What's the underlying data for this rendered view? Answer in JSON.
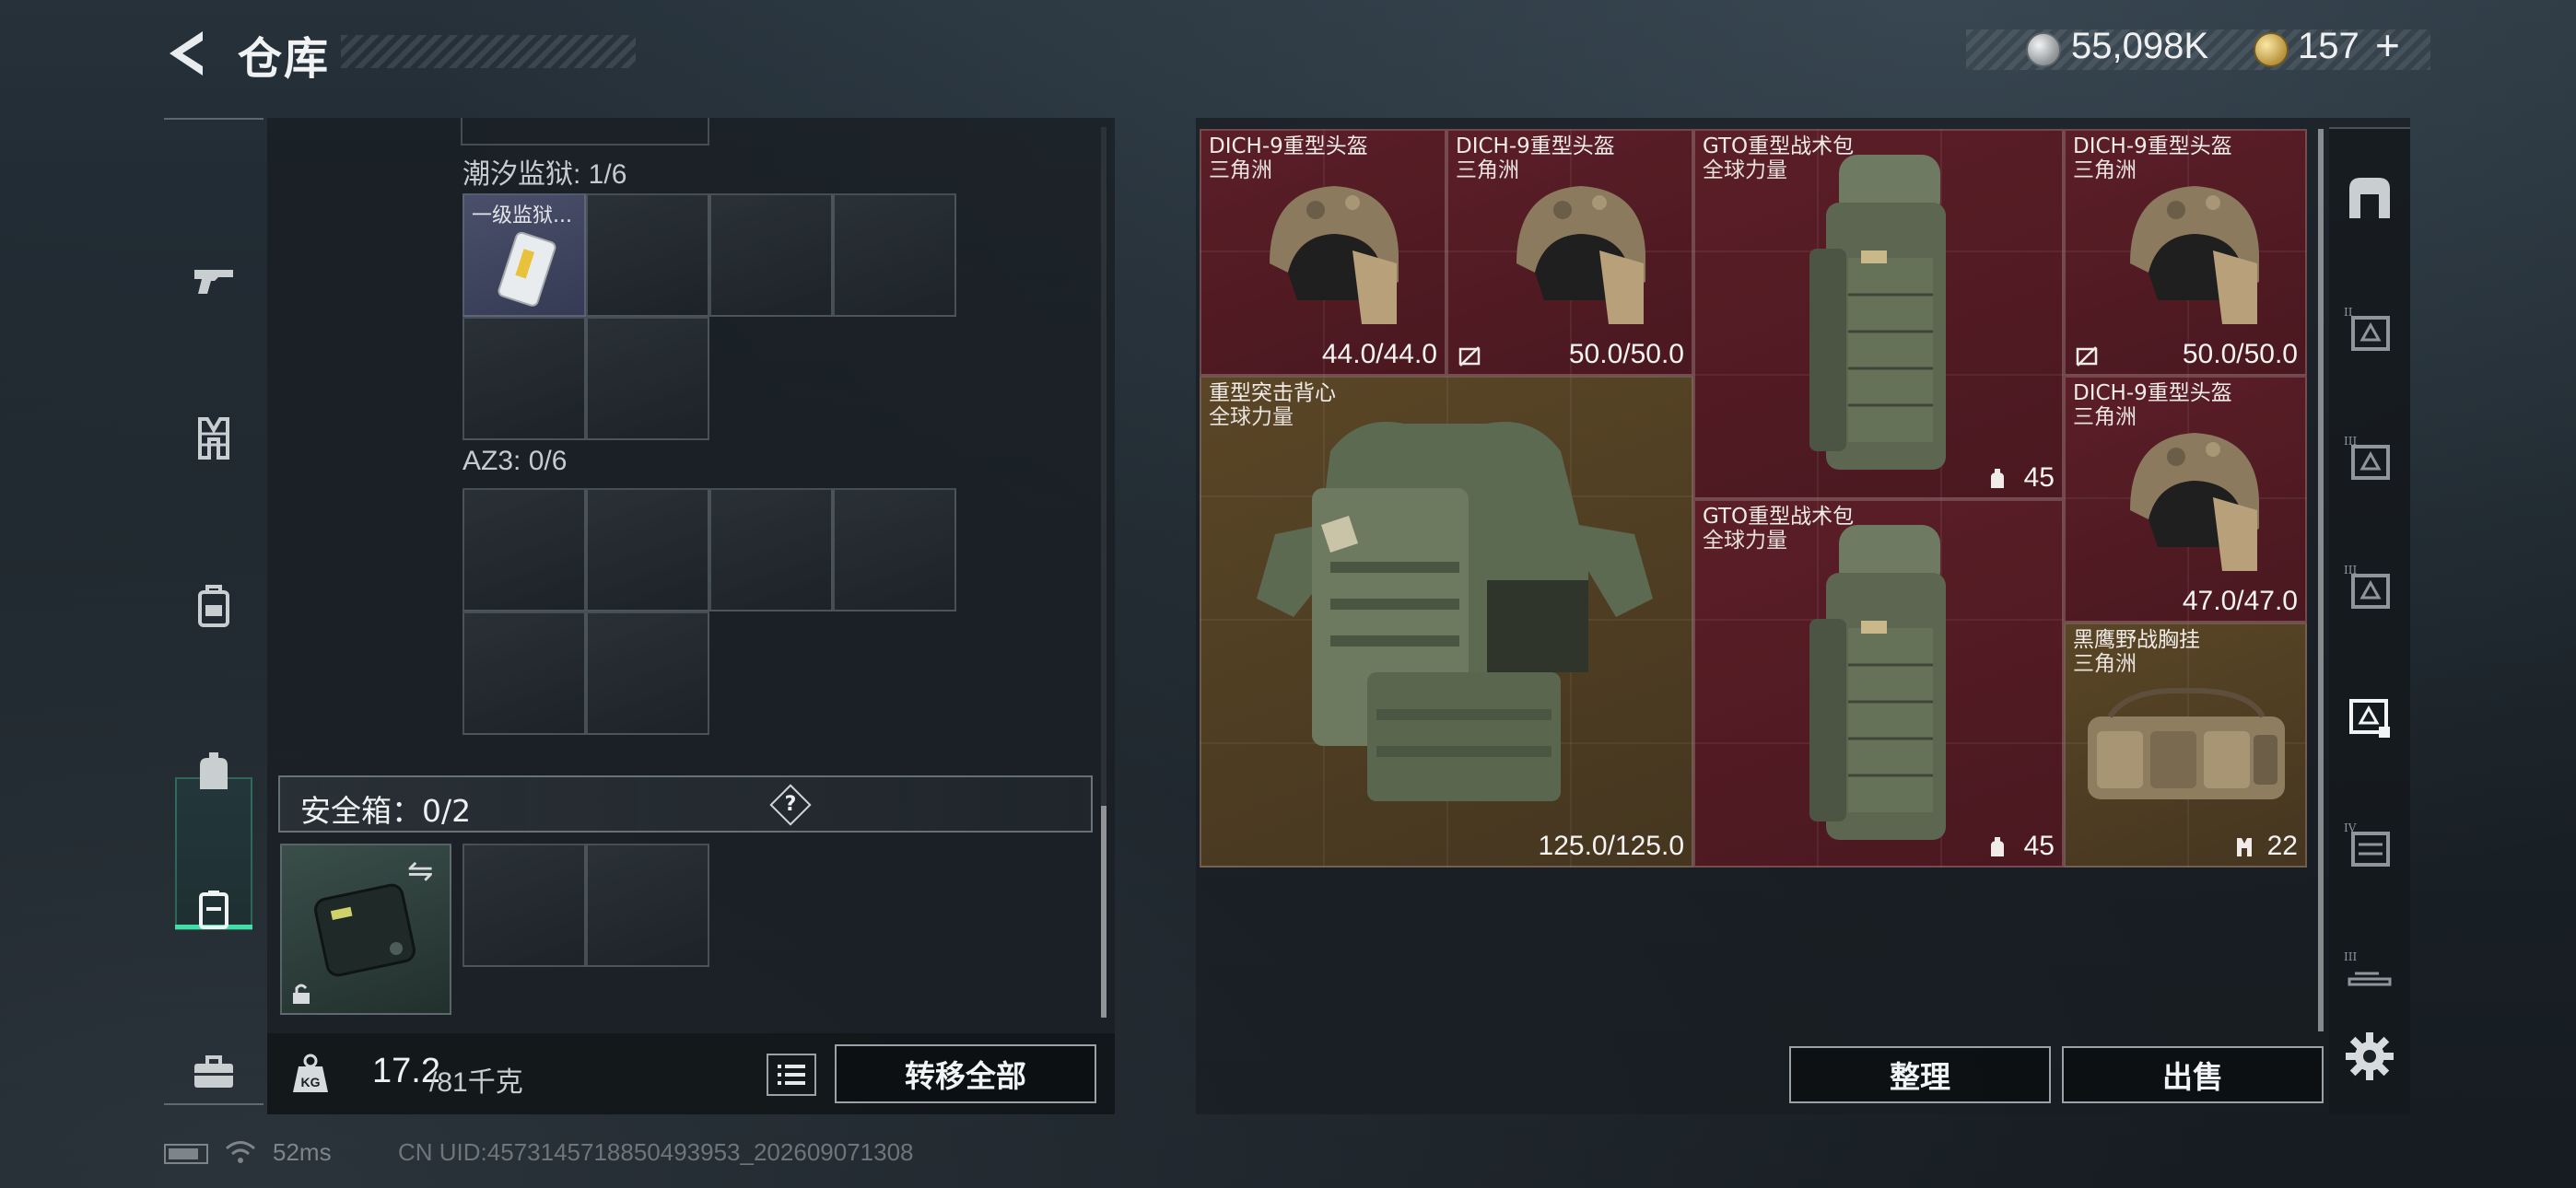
{
  "header": {
    "title": "仓库",
    "currency_silver": "55,098K",
    "currency_gold": "157",
    "gold_plus": "+"
  },
  "left_nav": {
    "items": [
      {
        "icon": "pistol-icon"
      },
      {
        "icon": "vest-icon"
      },
      {
        "icon": "backpack-icon"
      },
      {
        "icon": "pouch-icon"
      },
      {
        "icon": "secure-case-icon",
        "active": true
      },
      {
        "icon": "toolbox-icon"
      }
    ]
  },
  "containers": {
    "prison": {
      "label": "潮汐监狱: 1/6",
      "item_label": "一级监狱..."
    },
    "az3": {
      "label": "AZ3: 0/6"
    },
    "safe": {
      "label": "安全箱：0/2",
      "help": "?"
    }
  },
  "weight": {
    "current": "17.2",
    "max": "/81千克"
  },
  "buttons": {
    "transfer_all": "转移全部",
    "sort": "整理",
    "sell": "出售"
  },
  "stash_items": [
    {
      "name": "DICH-9重型头盔",
      "sub": "三角洲",
      "value": "44.0/44.0",
      "rarity": "red"
    },
    {
      "name": "DICH-9重型头盔",
      "sub": "三角洲",
      "value": "50.0/50.0",
      "rarity": "red"
    },
    {
      "name": "GTO重型战术包",
      "sub": "全球力量",
      "value": "45",
      "rarity": "red"
    },
    {
      "name": "DICH-9重型头盔",
      "sub": "三角洲",
      "value": "50.0/50.0",
      "rarity": "red"
    },
    {
      "name": "重型突击背心",
      "sub": "全球力量",
      "value": "125.0/125.0",
      "rarity": "gold"
    },
    {
      "name": "GTO重型战术包",
      "sub": "全球力量",
      "value": "45",
      "rarity": "red"
    },
    {
      "name": "DICH-9重型头盔",
      "sub": "三角洲",
      "value": "47.0/47.0",
      "rarity": "red"
    },
    {
      "name": "黑鹰野战胸挂",
      "sub": "三角洲",
      "value": "22",
      "rarity": "gold"
    }
  ],
  "right_side": {
    "items": [
      {
        "icon": "stash-home-icon"
      },
      {
        "icon": "stash-tab-II-icon",
        "numeral": "II"
      },
      {
        "icon": "stash-tab-III-icon",
        "numeral": "III"
      },
      {
        "icon": "stash-tab-III-icon",
        "numeral": "III"
      },
      {
        "icon": "stash-tab-active-icon"
      },
      {
        "icon": "stash-tab-IV-icon",
        "numeral": "IV"
      },
      {
        "icon": "stash-tab-III-icon",
        "numeral": "III"
      },
      {
        "icon": "gear-icon"
      }
    ]
  },
  "footer": {
    "ping": "52ms",
    "uid": "CN UID:4573145718850493953_202609071308"
  },
  "colors": {
    "accent": "#3fe0a8",
    "rarity_red": "#5b1e27",
    "rarity_gold": "#5a4626"
  }
}
